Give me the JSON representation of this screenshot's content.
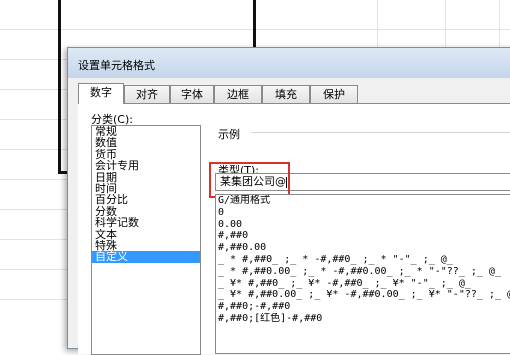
{
  "dialog": {
    "title": "设置单元格格式",
    "tabs": [
      "数字",
      "对齐",
      "字体",
      "边框",
      "填充",
      "保护"
    ],
    "active_tab": "数字",
    "category_label": "分类(C):",
    "categories": [
      "常规",
      "数值",
      "货币",
      "会计专用",
      "日期",
      "时间",
      "百分比",
      "分数",
      "科学记数",
      "文本",
      "特殊",
      "自定义"
    ],
    "selected_category": "自定义",
    "sample_label": "示例",
    "type_label": "类型(T):",
    "type_value": "某集团公司@",
    "formats": [
      "G/通用格式",
      "0",
      "0.00",
      "#,##0",
      "#,##0.00",
      "_ * #,##0_ ;_ * -#,##0_ ;_ * \"-\"_ ;_ @_ ",
      "_ * #,##0.00_ ;_ * -#,##0.00_ ;_ * \"-\"??_ ;_ @_ ",
      "_ ¥* #,##0_ ;_ ¥* -#,##0_ ;_ ¥* \"-\"_ ;_ @_ ",
      "_ ¥* #,##0.00_ ;_ ¥* -#,##0.00_ ;_ ¥* \"-\"??_ ;_ @_ ",
      "#,##0;-#,##0",
      "#,##0;[红色]-#,##0"
    ]
  },
  "colors": {
    "selection": "#3399ff",
    "highlight_frame": "#d9312b"
  }
}
